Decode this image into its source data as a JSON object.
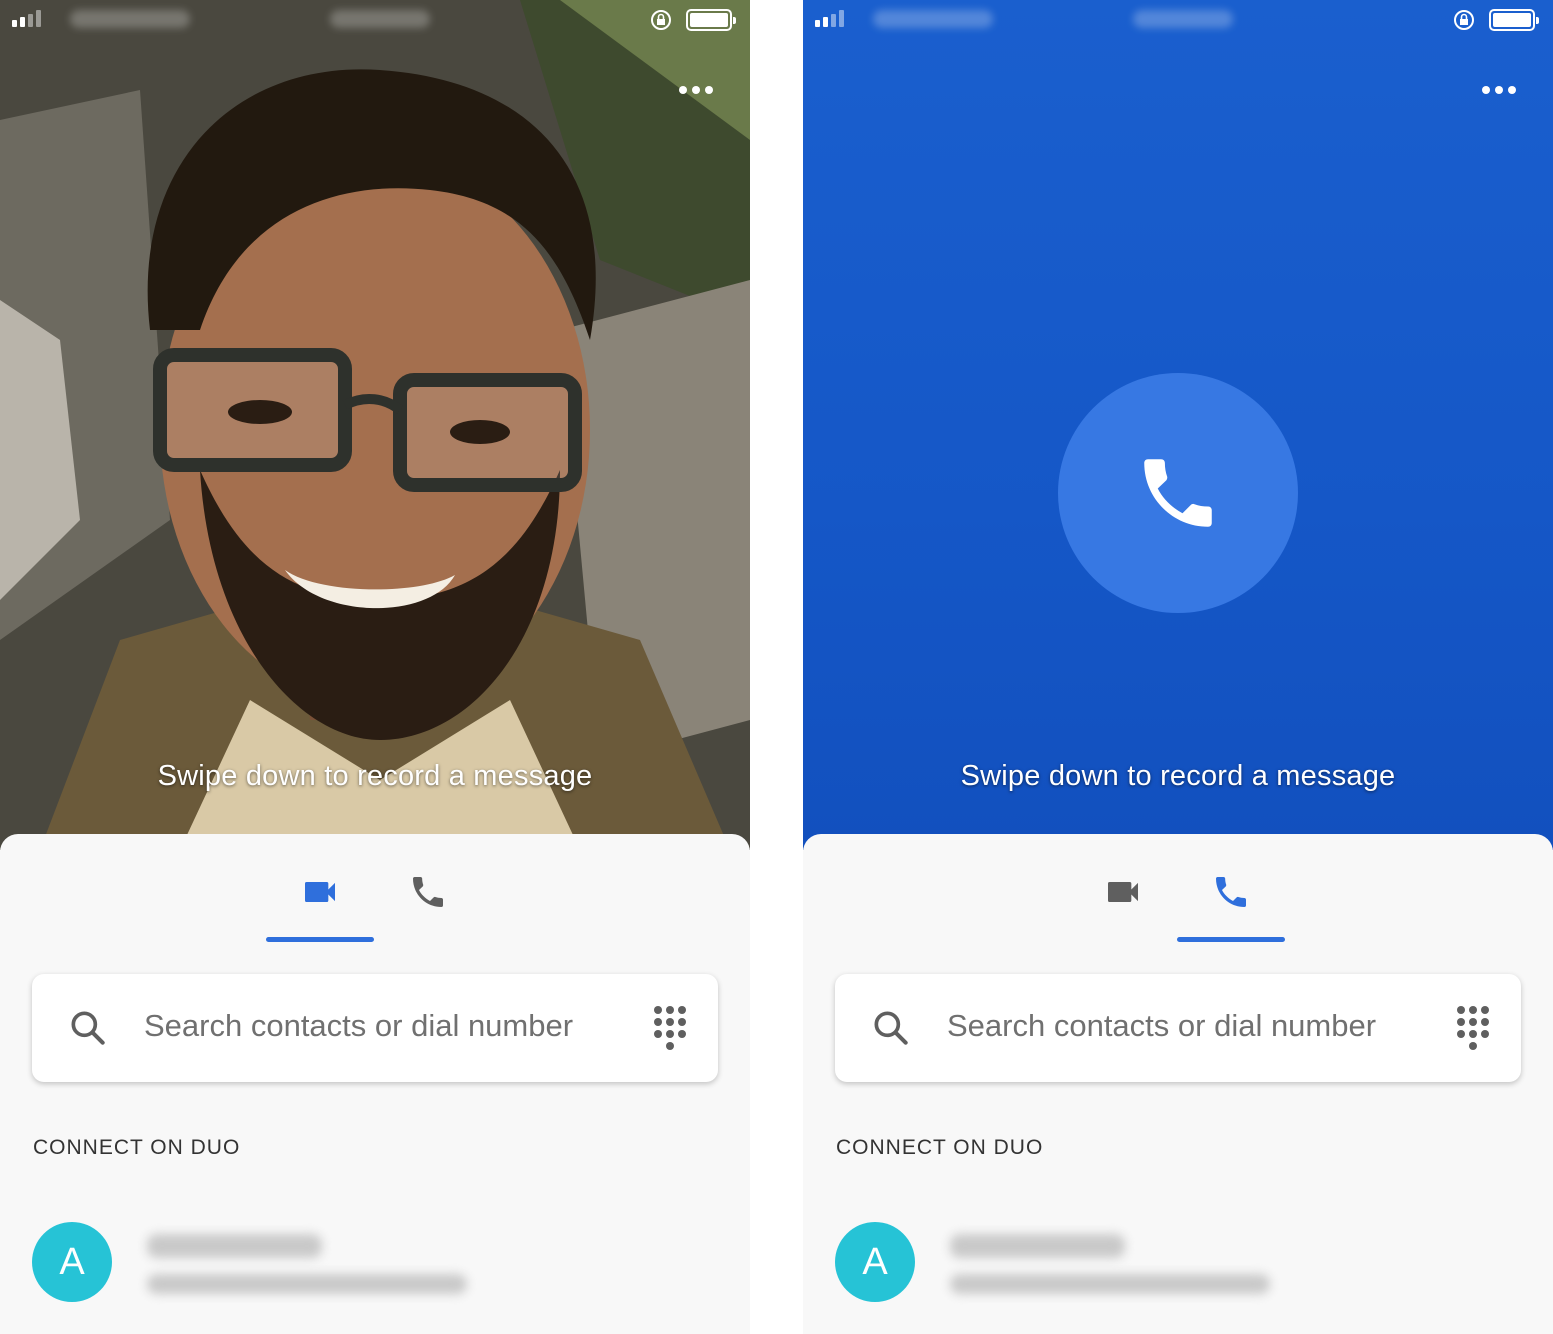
{
  "colors": {
    "accent_blue": "#2f6fdc",
    "inactive_icon": "#5f5f5f",
    "avatar_teal": "#26c3d6",
    "audio_background": "#1557c7",
    "call_button": "#3778e3"
  },
  "screens": [
    {
      "mode": "video",
      "swipe_hint": "Swipe down to record a message",
      "tabs": [
        {
          "icon": "video-camera-icon",
          "active": true
        },
        {
          "icon": "phone-icon",
          "active": false
        }
      ],
      "search": {
        "placeholder": "Search contacts or dial number"
      },
      "section_label": "CONNECT ON DUO",
      "contacts": [
        {
          "avatar_letter": "A"
        }
      ]
    },
    {
      "mode": "audio",
      "swipe_hint": "Swipe down to record a message",
      "tabs": [
        {
          "icon": "video-camera-icon",
          "active": false
        },
        {
          "icon": "phone-icon",
          "active": true
        }
      ],
      "search": {
        "placeholder": "Search contacts or dial number"
      },
      "section_label": "CONNECT ON DUO",
      "contacts": [
        {
          "avatar_letter": "A"
        }
      ]
    }
  ]
}
